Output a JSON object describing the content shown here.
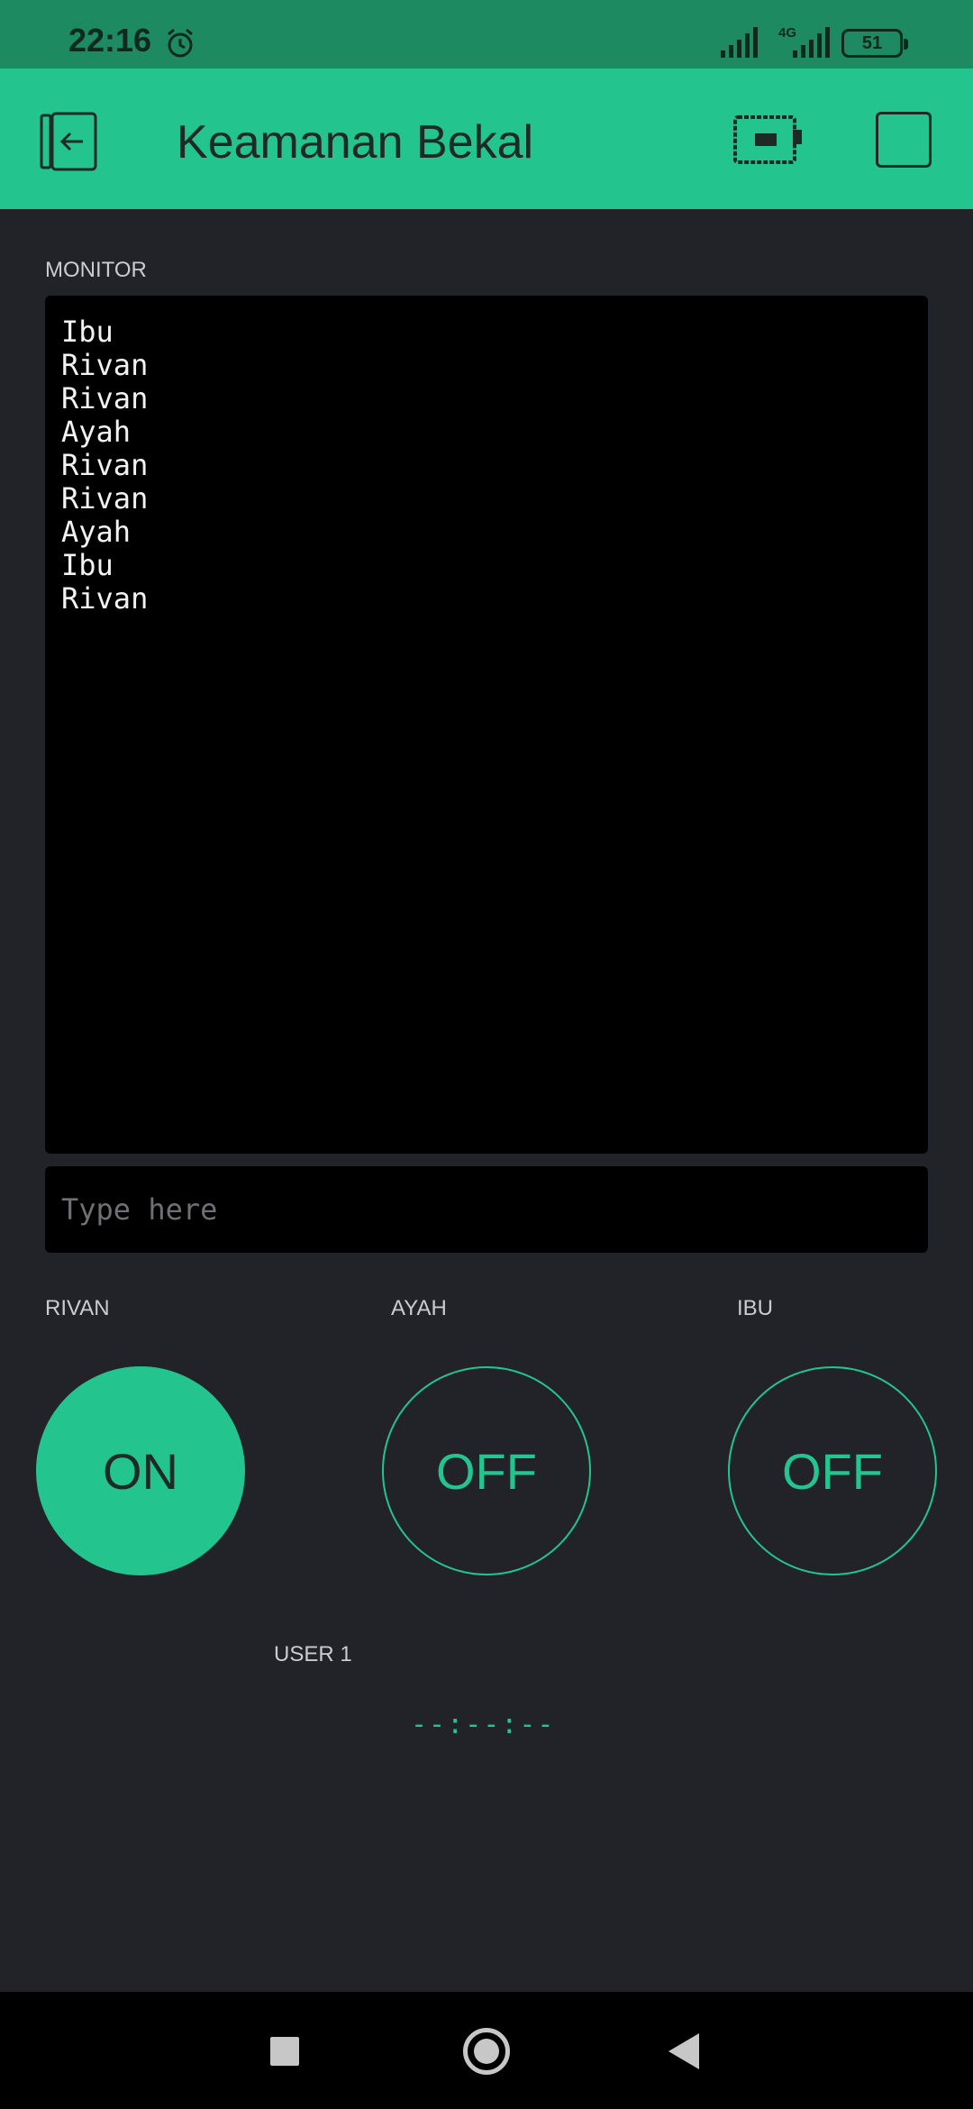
{
  "status_bar": {
    "time": "22:16",
    "network": "4G",
    "battery": "51",
    "icons": [
      "alarm-icon",
      "signal-icon",
      "signal-icon",
      "battery-icon"
    ]
  },
  "app_bar": {
    "title": "Keamanan Bekal",
    "icons": [
      "back-icon",
      "device-icon",
      "square-icon"
    ]
  },
  "terminal": {
    "label": "MONITOR",
    "lines": [
      "Ibu",
      "Rivan",
      "Rivan",
      "Ayah",
      "Rivan",
      "Rivan",
      "Ayah",
      "Ibu",
      "Rivan"
    ],
    "input_value": "",
    "input_placeholder": "Type here"
  },
  "buttons": [
    {
      "label": "RIVAN",
      "state": "ON"
    },
    {
      "label": "AYAH",
      "state": "OFF"
    },
    {
      "label": "IBU",
      "state": "OFF"
    }
  ],
  "timer": {
    "label": "USER 1",
    "value": "--:--:--"
  },
  "colors": {
    "accent": "#23c48e",
    "background": "#222328",
    "status_bar": "#1e8a62",
    "terminal_bg": "#000000"
  }
}
